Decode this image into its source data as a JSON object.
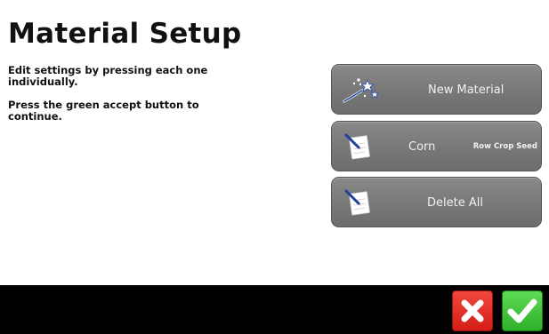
{
  "screen": {
    "title": "Material Setup",
    "instructions": [
      "Edit settings by pressing each one individually.",
      "Press the green accept button to continue."
    ]
  },
  "buttons": {
    "new_material": {
      "label": "New Material",
      "icon": "magic-wand-icon"
    },
    "corn": {
      "label": "Corn",
      "sublabel": "Row Crop Seed",
      "icon": "edit-notepad-icon"
    },
    "delete_all": {
      "label": "Delete All",
      "icon": "edit-notepad-icon"
    }
  },
  "bottom_bar": {
    "cancel_icon": "close-icon",
    "accept_icon": "checkmark-icon"
  },
  "colors": {
    "button_gray": "#7a7a7a",
    "cancel_red": "#d41e17",
    "accept_green": "#2fae2b",
    "bar_black": "#000000"
  }
}
